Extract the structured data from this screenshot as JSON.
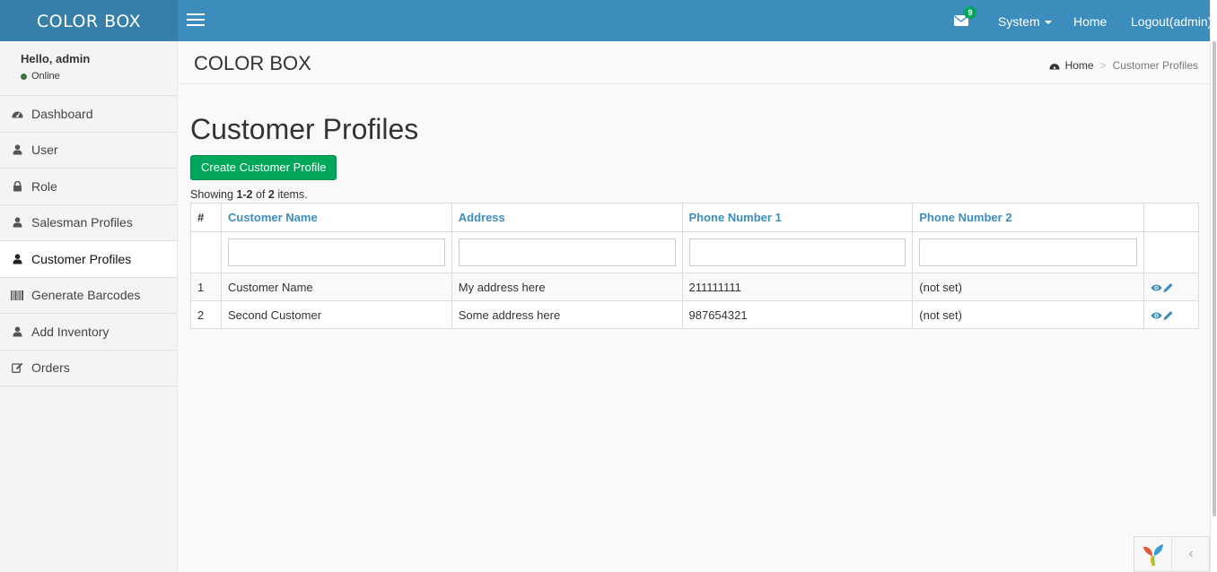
{
  "brand": {
    "logo_text": "COLOR BOX"
  },
  "topnav": {
    "mail_badge": "9",
    "system_label": "System",
    "home_label": "Home",
    "logout_label": "Logout(admin)"
  },
  "sidebar": {
    "greeting": "Hello, admin",
    "status": "Online",
    "items": [
      {
        "label": "Dashboard",
        "icon": "dashboard-icon"
      },
      {
        "label": "User",
        "icon": "user-icon"
      },
      {
        "label": "Role",
        "icon": "lock-icon"
      },
      {
        "label": "Salesman Profiles",
        "icon": "user-icon"
      },
      {
        "label": "Customer Profiles",
        "icon": "user-icon",
        "active": true
      },
      {
        "label": "Generate Barcodes",
        "icon": "barcode-icon"
      },
      {
        "label": "Add Inventory",
        "icon": "user-icon"
      },
      {
        "label": "Orders",
        "icon": "edit-icon"
      }
    ]
  },
  "header": {
    "title": "COLOR BOX",
    "breadcrumb_home": "Home",
    "breadcrumb_current": "Customer Profiles"
  },
  "main": {
    "title": "Customer Profiles",
    "create_button": "Create Customer Profile",
    "summary": {
      "prefix": "Showing ",
      "range": "1-2",
      "middle": " of ",
      "total": "2",
      "suffix": " items."
    },
    "table": {
      "columns": [
        "#",
        "Customer Name",
        "Address",
        "Phone Number 1",
        "Phone Number 2"
      ],
      "rows": [
        {
          "num": "1",
          "name": "Customer Name",
          "address": "My address here",
          "phone1": "211111111",
          "phone2": "(not set)"
        },
        {
          "num": "2",
          "name": "Second Customer",
          "address": "Some address here",
          "phone1": "987654321",
          "phone2": "(not set)"
        }
      ]
    }
  },
  "colors": {
    "header": "#3c8dbc",
    "logo_bg": "#367fa9",
    "create_button": "#00a65a",
    "link": "#3c8dbc"
  }
}
